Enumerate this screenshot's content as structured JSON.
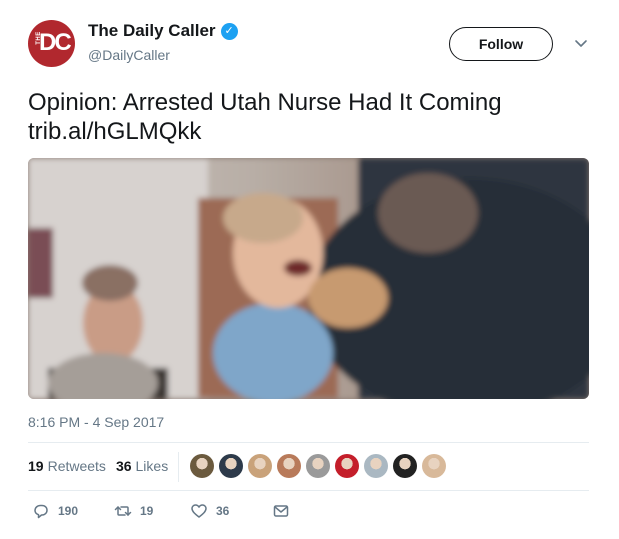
{
  "account": {
    "display_name": "The Daily Caller",
    "handle": "@DailyCaller",
    "avatar_text_small": "THE",
    "avatar_text_large": "DC",
    "verified": true
  },
  "follow_label": "Follow",
  "tweet": {
    "line1": "Opinion: Arrested Utah Nurse Had It Coming",
    "line2": "trib.al/hGLMQkk",
    "timestamp": "8:16 PM - 4 Sep 2017"
  },
  "stats": {
    "retweets_count": "19",
    "retweets_label": "Retweets",
    "likes_count": "36",
    "likes_label": "Likes"
  },
  "liker_avatars": [
    {
      "color": "#6b5a3e"
    },
    {
      "color": "#2d3a4a"
    },
    {
      "color": "#c9a27a"
    },
    {
      "color": "#b87a5a"
    },
    {
      "color": "#9a9a9a"
    },
    {
      "color": "#c41e2a"
    },
    {
      "color": "#aab8c2"
    },
    {
      "color": "#222222"
    },
    {
      "color": "#d8b99a"
    }
  ],
  "actions": {
    "replies": "190",
    "retweets": "19",
    "likes": "36"
  },
  "colors": {
    "brand_red": "#b1282e",
    "verified_blue": "#1da1f2",
    "muted_text": "#657786"
  }
}
